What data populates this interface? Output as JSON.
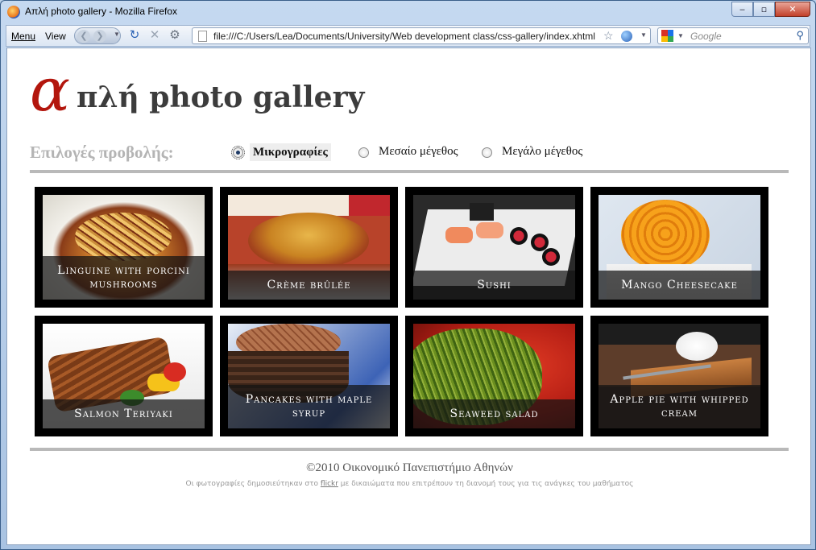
{
  "window": {
    "title": "Απλή photo gallery - Mozilla Firefox"
  },
  "titlebar_buttons": {
    "minimize": "‒",
    "maximize": "▫",
    "close": "✕"
  },
  "toolbar": {
    "menu_label": "Menu",
    "view_label": "View",
    "url": "file:///C:/Users/Lea/Documents/University/Web development class/css-gallery/index.xhtml",
    "search_placeholder": "Google"
  },
  "icons": [
    "firefox-icon",
    "back-icon",
    "forward-icon",
    "reload-icon",
    "stop-icon",
    "home-icon",
    "page-icon",
    "star-icon",
    "globe-icon",
    "google-icon",
    "magnifier-icon"
  ],
  "page": {
    "logo_alpha": "α",
    "logo_rest": "πλή photo gallery",
    "views_label": "Επιλογές προβολής:",
    "view_options": [
      {
        "label": "Μικρογραφίες",
        "selected": true
      },
      {
        "label": "Μεσαίο μέγεθος",
        "selected": false
      },
      {
        "label": "Μεγάλο μέγεθος",
        "selected": false
      }
    ],
    "items": [
      {
        "caption": "Linguine with porcini mushrooms"
      },
      {
        "caption": "Crème brûlée"
      },
      {
        "caption": "Sushi"
      },
      {
        "caption": "Mango Cheesecake"
      },
      {
        "caption": "Salmon Teriyaki"
      },
      {
        "caption": "Pancakes with maple syrup"
      },
      {
        "caption": "Seaweed salad"
      },
      {
        "caption": "Apple pie with whipped cream"
      }
    ],
    "footer_copy": "©2010 Οικονομικό Πανεπιστήμιο Αθηνών",
    "footer_note_before": "Οι φωτογραφίες δημοσιεύτηκαν στο ",
    "footer_link": "flickr",
    "footer_note_after": " με δικαιώματα που επιτρέπουν τη διανομή τους για τις ανάγκες του μαθήματος"
  },
  "colors": {
    "accent_red": "#b3160d",
    "rule_gray": "#b9b9b9",
    "tile_black": "#000000"
  }
}
